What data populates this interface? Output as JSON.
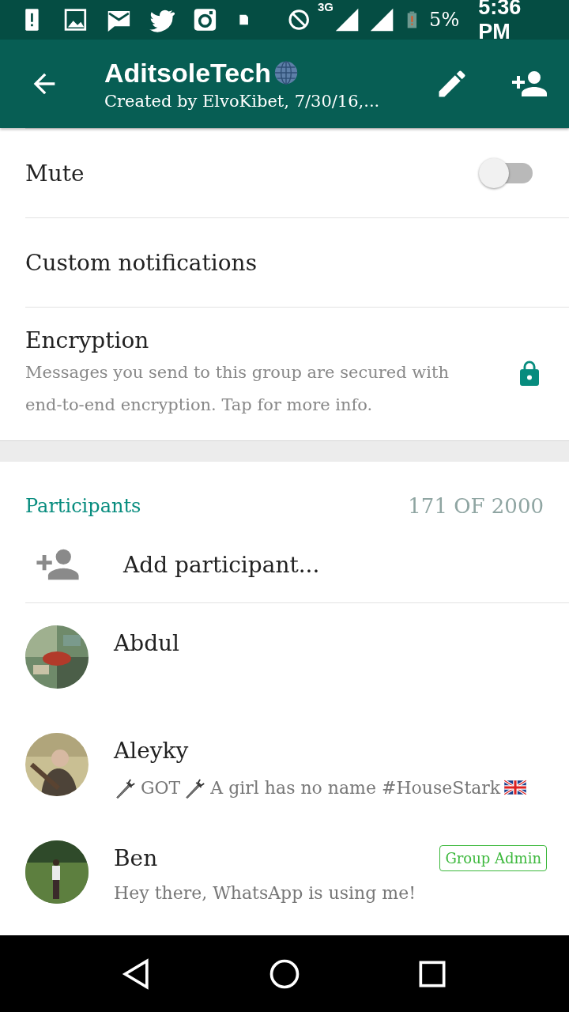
{
  "status_bar": {
    "network": "3G",
    "battery": "5%",
    "time": "5:36 PM"
  },
  "header": {
    "title": "AditsoleTech",
    "subtitle": "Created by ElvoKibet, 7/30/16,..."
  },
  "settings": [
    {
      "kind": "toggle",
      "label": "Mute",
      "on": false
    },
    {
      "kind": "plain",
      "label": "Custom notifications"
    },
    {
      "kind": "lock",
      "label": "Encryption",
      "description": "Messages you send to this group are secured with end-to-end encryption. Tap for more info."
    }
  ],
  "participants": {
    "title": "Participants",
    "count": "171 OF 2000",
    "add_label": "Add participant...",
    "members": [
      {
        "name": "Abdul",
        "admin": false
      },
      {
        "name": "Aleyky",
        "admin": false,
        "status": [
          {
            "kind": "dagger"
          },
          {
            "kind": "text",
            "text": "GOT"
          },
          {
            "kind": "dagger"
          },
          {
            "kind": "text",
            "text": "A girl has no name #HouseStark"
          },
          {
            "kind": "flag"
          }
        ]
      },
      {
        "name": "Ben",
        "admin": true,
        "admin_label": "Group Admin",
        "status": [
          {
            "kind": "text",
            "text": "Hey there, WhatsApp is using me!"
          }
        ]
      }
    ]
  }
}
